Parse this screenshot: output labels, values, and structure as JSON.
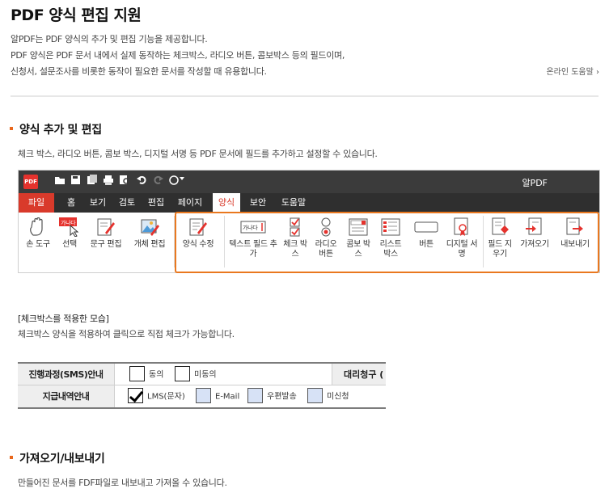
{
  "header": {
    "title": "PDF 양식 편집 지원",
    "desc_lines": [
      "알PDF는 PDF 양식의 추가 및 편집 기능을 제공합니다.",
      "PDF 양식은 PDF 문서 내에서 실제 동작하는 체크박스, 라디오 버튼, 콤보박스 등의 필드이며,",
      "신청서, 설문조사를 비롯한 동작이 필요한 문서를 작성할 때 유용합니다."
    ],
    "help_link": "온라인 도움말 ›"
  },
  "section1": {
    "title": "양식 추가 및 편집",
    "desc": "체크 박스, 라디오 버튼, 콤보 박스, 디지털 서명 등 PDF 문서에 필드를 추가하고 설정할 수 있습니다."
  },
  "app": {
    "title": "알PDF",
    "logo_text": "PDF",
    "menus": [
      "파일",
      "홈",
      "보기",
      "검토",
      "편집",
      "페이지",
      "양식",
      "보안",
      "도움말"
    ],
    "active_menu": "양식",
    "tools": [
      {
        "label": "손 도구",
        "icon": "hand-icon"
      },
      {
        "label": "선택",
        "icon": "select-icon"
      },
      {
        "label": "문구 편집",
        "icon": "text-edit-icon"
      },
      {
        "label": "개체 편집",
        "icon": "object-edit-icon"
      },
      {
        "label": "양식 수정",
        "icon": "form-edit-icon"
      },
      {
        "label": "텍스트 필드 추가",
        "icon": "text-field-icon"
      },
      {
        "label": "체크 박스",
        "icon": "checkbox-icon"
      },
      {
        "label": "라디오 버튼",
        "icon": "radio-button-icon"
      },
      {
        "label": "콤보 박스",
        "icon": "combo-box-icon"
      },
      {
        "label": "리스트 박스",
        "icon": "list-box-icon"
      },
      {
        "label": "버튼",
        "icon": "button-icon"
      },
      {
        "label": "디지털 서명",
        "icon": "digital-signature-icon"
      },
      {
        "label": "필드 지우기",
        "icon": "clear-fields-icon"
      },
      {
        "label": "가져오기",
        "icon": "import-icon"
      },
      {
        "label": "내보내기",
        "icon": "export-icon"
      }
    ],
    "icon_text": "가나다",
    "highlight_color": "#e9781f"
  },
  "example": {
    "caption": "[체크박스를 적용한 모습]",
    "desc": "체크박스 양식을 적용하여 클릭으로 직접 체크가 가능합니다.",
    "row1_header": "진행과정(SMS)안내",
    "row1_options": [
      "동의",
      "미동의"
    ],
    "row1_header2": "대리청구 (",
    "row2_header": "지급내역안내",
    "row2_options": [
      "LMS(문자)",
      "E-Mail",
      "우편발송",
      "미신청"
    ]
  },
  "section2": {
    "title": "가져오기/내보내기",
    "desc": "만들어진 문서를 FDF파일로 내보내고 가져올 수 있습니다."
  }
}
